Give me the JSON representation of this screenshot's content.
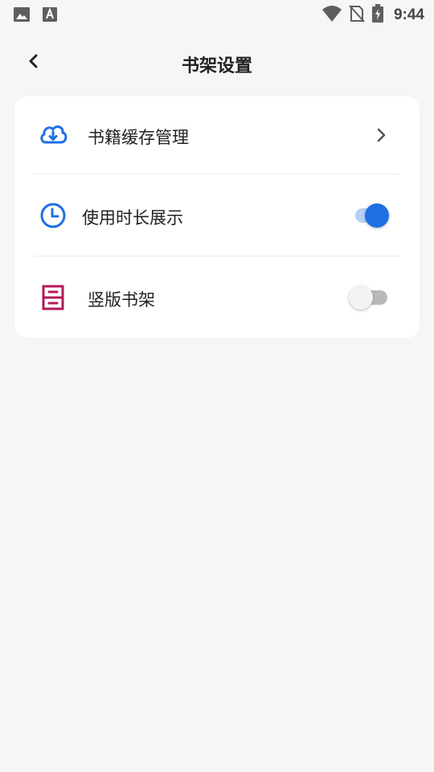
{
  "status_bar": {
    "left_icons": [
      "image-icon",
      "text-a-icon"
    ],
    "right_icons": [
      "wifi-icon",
      "no-sim-icon",
      "battery-charging-icon"
    ],
    "time": "9:44"
  },
  "header": {
    "title": "书架设置",
    "back_icon": "chevron-left-icon"
  },
  "settings": {
    "items": [
      {
        "label": "书籍缓存管理",
        "icon": "cloud-download-icon",
        "icon_color": "#1f6fe5",
        "control": "chevron"
      },
      {
        "label": "使用时长展示",
        "icon": "clock-icon",
        "icon_color": "#1f6fe5",
        "control": "toggle",
        "checked": true
      },
      {
        "label": "竖版书架",
        "icon": "cabinet-icon",
        "icon_color": "#b31a5a",
        "control": "toggle",
        "checked": false
      }
    ]
  },
  "colors": {
    "accent": "#1f6fe5",
    "background": "#f6f6f6",
    "card": "#ffffff",
    "toggle_track_on": "#b7d0f7",
    "toggle_off": "#b9b9b9"
  }
}
